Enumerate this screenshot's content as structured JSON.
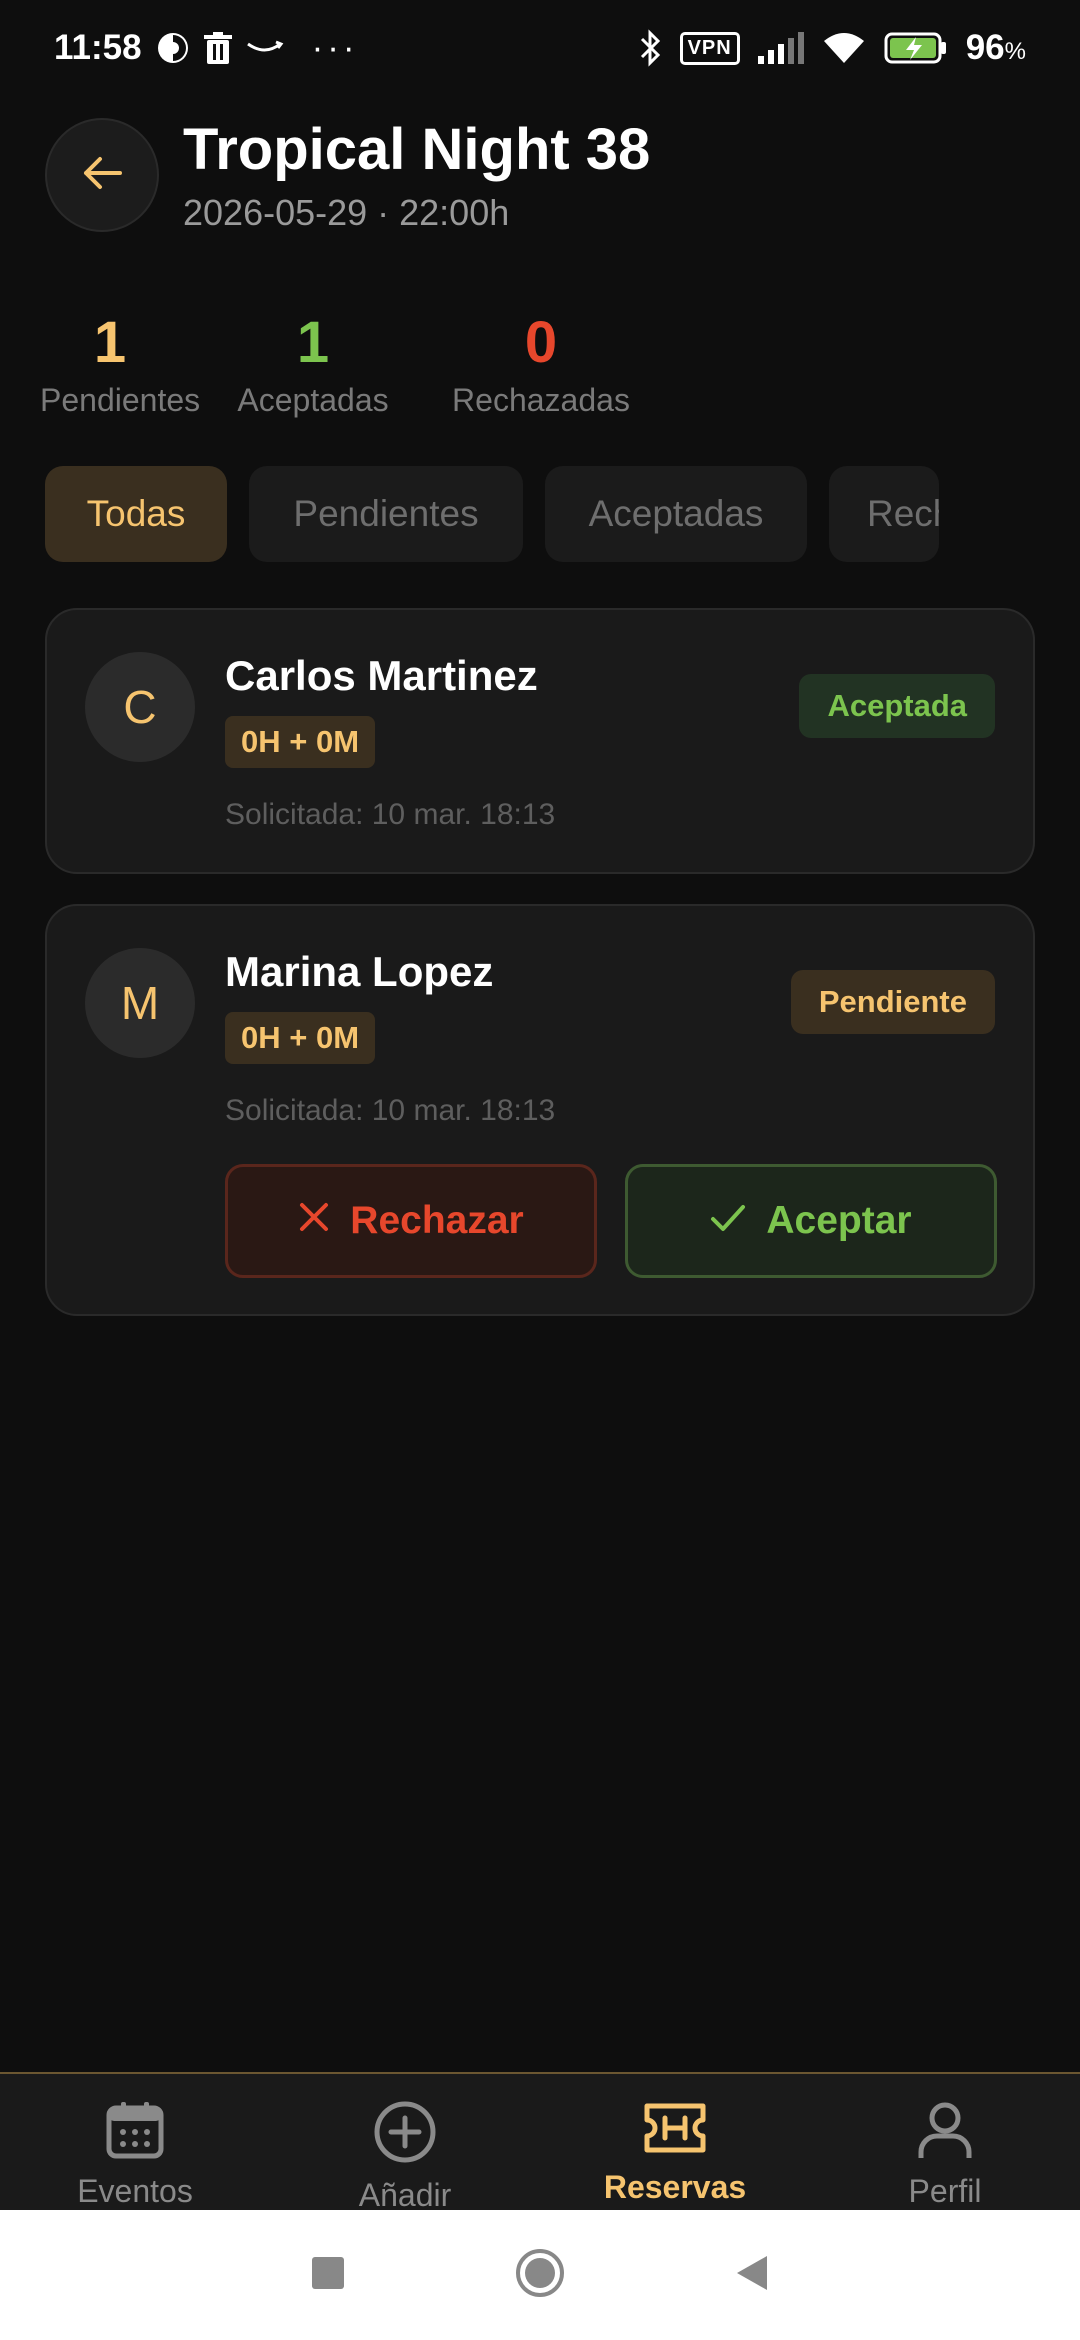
{
  "status_bar": {
    "time": "11:58",
    "battery": "96",
    "battery_suffix": "%",
    "vpn": "VPN",
    "more": "···"
  },
  "header": {
    "title": "Tropical Night 38",
    "subtitle": "2026-05-29 · 22:00h"
  },
  "stats": [
    {
      "value": "1",
      "label": "Pendientes",
      "color": "#f6c46f"
    },
    {
      "value": "1",
      "label": "Aceptadas",
      "color": "#7cc44e"
    },
    {
      "value": "0",
      "label": "Rechazadas",
      "color": "#e7472c"
    }
  ],
  "tabs": [
    {
      "label": "Todas",
      "active": true
    },
    {
      "label": "Pendientes",
      "active": false
    },
    {
      "label": "Aceptadas",
      "active": false
    },
    {
      "label": "Rechazadas",
      "active": false
    }
  ],
  "reservations": [
    {
      "initial": "C",
      "name": "Carlos Martinez",
      "duration": "0H + 0M",
      "requested": "Solicitada: 10 mar. 18:13",
      "status": "Aceptada"
    },
    {
      "initial": "M",
      "name": "Marina Lopez",
      "duration": "0H + 0M",
      "requested": "Solicitada: 10 mar. 18:13",
      "status": "Pendiente",
      "reject_label": "Rechazar",
      "accept_label": "Aceptar"
    }
  ],
  "bottom_nav": [
    {
      "label": "Eventos",
      "icon": "calendar-icon",
      "active": false
    },
    {
      "label": "Añadir",
      "icon": "add-circle-icon",
      "active": false
    },
    {
      "label": "Reservas",
      "icon": "ticket-icon",
      "active": true
    },
    {
      "label": "Perfil",
      "icon": "person-icon",
      "active": false
    }
  ],
  "colors": {
    "accent": "#f6c46f",
    "success": "#7cc44e",
    "danger": "#e7472c",
    "background": "#0e0e0e"
  }
}
